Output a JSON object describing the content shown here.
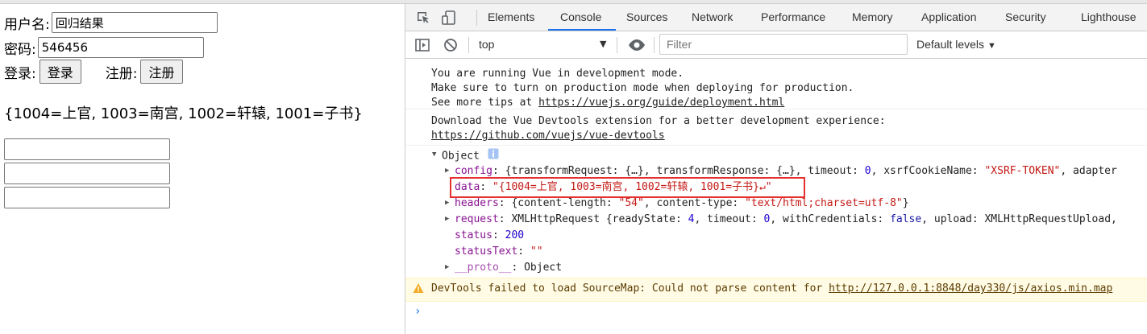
{
  "form": {
    "username_label": "用户名:",
    "username_value": "回归结果",
    "password_label": "密码:",
    "password_value": "546456",
    "login_label": "登录:",
    "login_button": "登录",
    "register_label": "注册:",
    "register_button": "注册",
    "result_text": "{1004=上官, 1003=南宫, 1002=轩辕, 1001=子书}"
  },
  "devtools": {
    "tabs": [
      "Elements",
      "Console",
      "Sources",
      "Network",
      "Performance",
      "Memory",
      "Application",
      "Security",
      "Lighthouse"
    ],
    "active_tab": "Console",
    "context": "top",
    "filter_placeholder": "Filter",
    "levels": "Default levels",
    "accent": "#1a73e8",
    "icons": [
      "inspect-icon",
      "device-toolbar-icon",
      "sidebar-toggle-icon",
      "clear-console-icon",
      "eye-icon",
      "info-icon",
      "warning-icon",
      "prompt-chevron-icon"
    ]
  },
  "console": {
    "vue_msg_1": "You are running Vue in development mode.",
    "vue_msg_2": "Make sure to turn on production mode when deploying for production.",
    "vue_msg_3_prefix": "See more tips at ",
    "vue_msg_3_link": "https://vuejs.org/guide/deployment.html",
    "devtools_msg_1": "Download the Vue Devtools extension for a better development experience:",
    "devtools_msg_2_link": "https://github.com/vuejs/vue-devtools",
    "object_label": "Object",
    "config_key": "config",
    "config_value_1": "{transformRequest: {…}, transformResponse: {…}, timeout: ",
    "config_timeout": "0",
    "config_value_2": ", xsrfCookieName: ",
    "config_xsrf": "\"XSRF-TOKEN\"",
    "config_value_3": ", adapter",
    "data_key": "data",
    "data_value": "\"{1004=上官, 1003=南宫, 1002=轩辕, 1001=子书}↵\"",
    "headers_key": "headers",
    "headers_value_1": "{content-length: ",
    "headers_len": "\"54\"",
    "headers_value_2": ", content-type: ",
    "headers_type": "\"text/html;charset=utf-8\"",
    "headers_value_3": "}",
    "request_key": "request",
    "request_value_1": "XMLHttpRequest {readyState: ",
    "request_ready": "4",
    "request_value_2": ", timeout: ",
    "request_timeout": "0",
    "request_value_3": ", withCredentials: ",
    "request_cred": "false",
    "request_value_4": ", upload: XMLHttpRequestUpload,",
    "status_key": "status",
    "status_value": "200",
    "statustext_key": "statusText",
    "statustext_value": "\"\"",
    "proto_key": "__proto__",
    "proto_value": "Object",
    "warning_prefix": "DevTools failed to load SourceMap: Could not parse content for ",
    "warning_link": "http://127.0.0.1:8848/day330/js/axios.min.map",
    "highlight_color": "#e53030"
  }
}
